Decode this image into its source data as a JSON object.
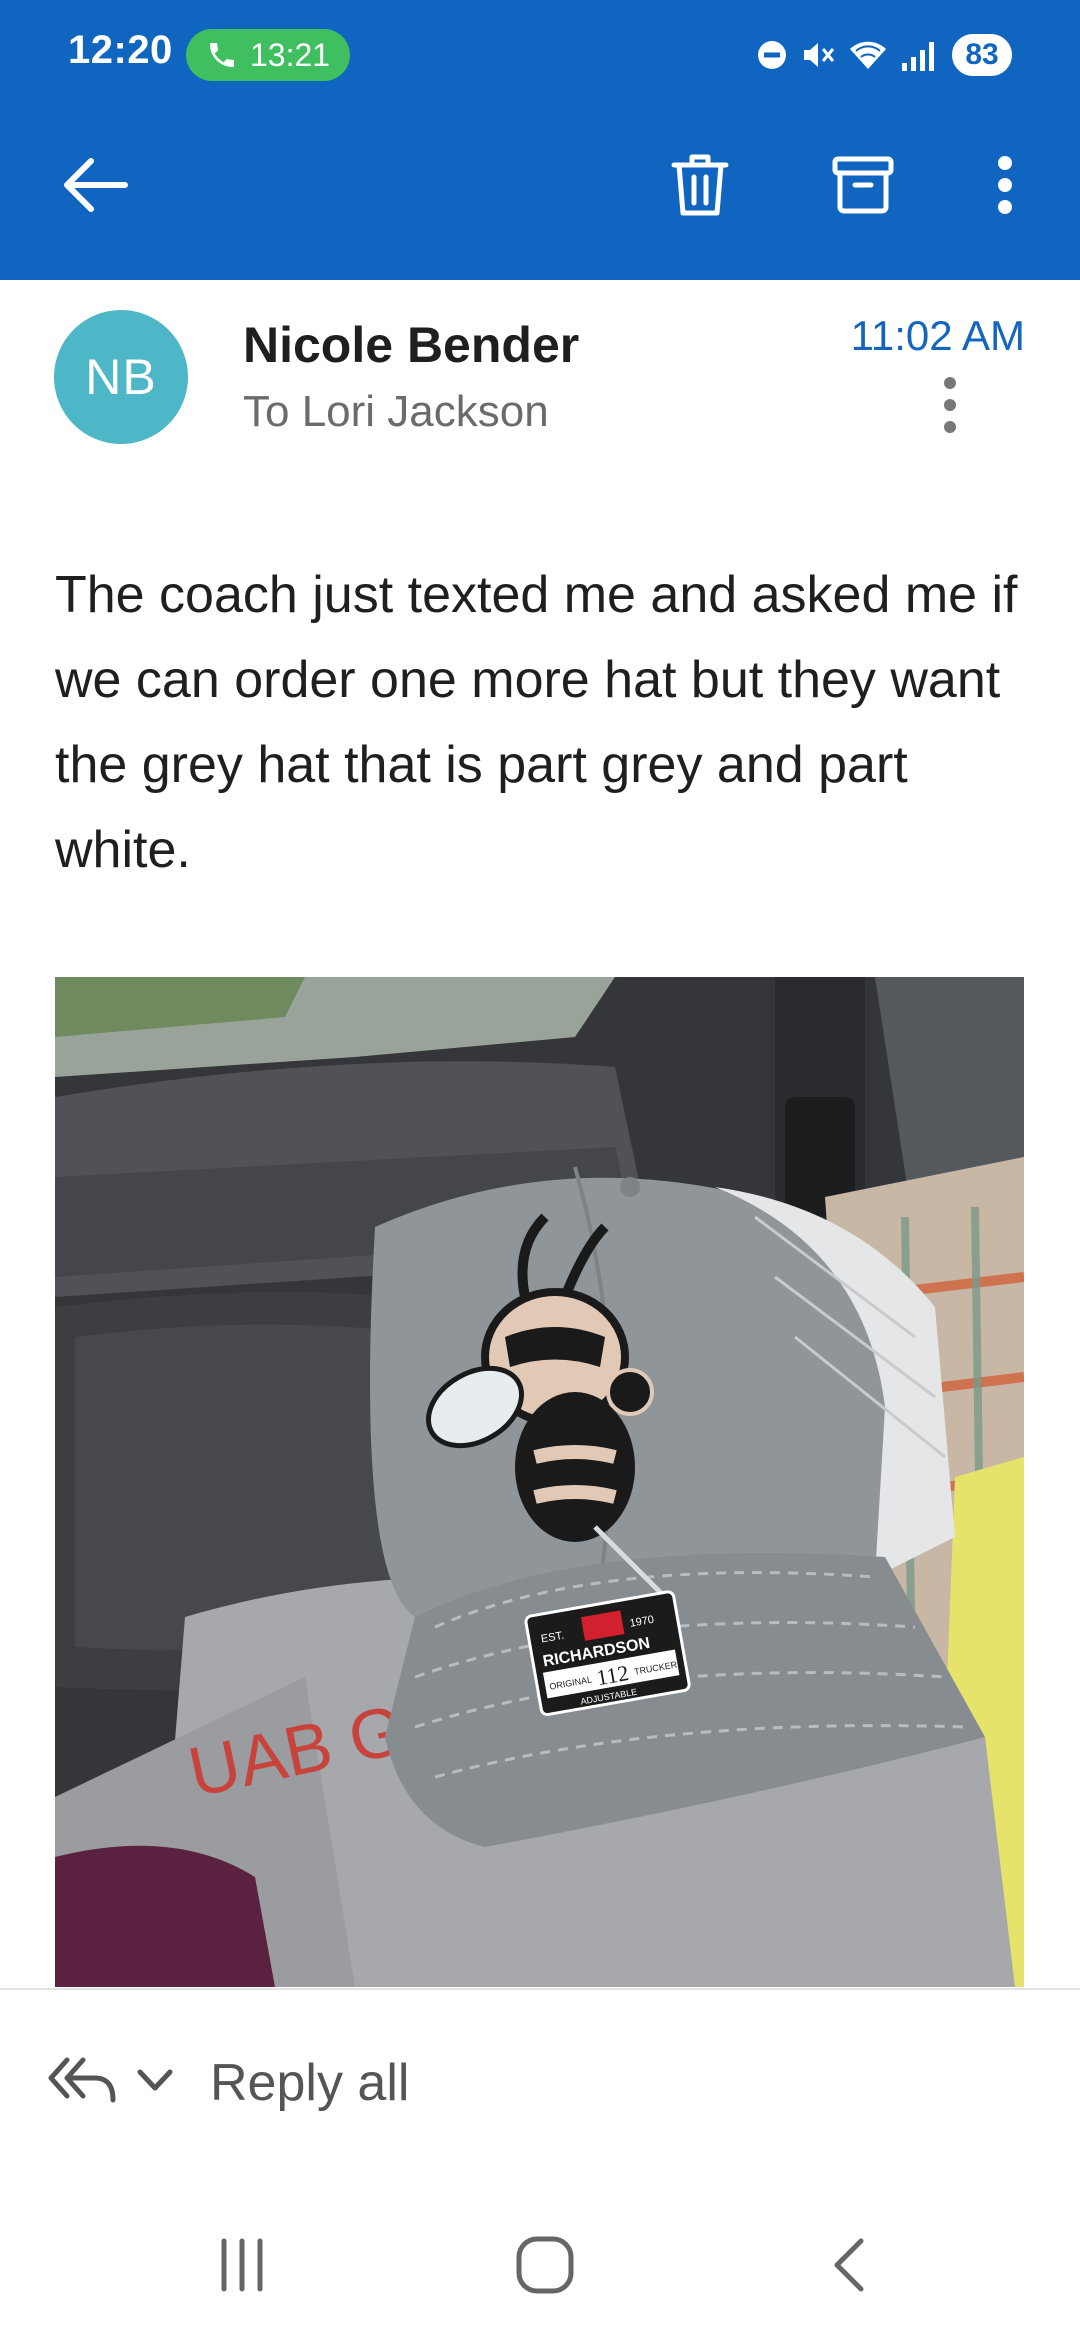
{
  "status_bar": {
    "time": "12:20",
    "call_duration": "13:21",
    "battery": "83",
    "icons": [
      "do-not-disturb-icon",
      "mute-icon",
      "wifi-icon",
      "signal-icon",
      "battery-icon"
    ]
  },
  "app_bar": {
    "actions": [
      "back-arrow-icon",
      "delete-icon",
      "archive-icon",
      "more-vert-icon"
    ]
  },
  "message": {
    "sender_initials": "NB",
    "sender_name": "Nicole Bender",
    "to_prefix": "To ",
    "recipient_name": "Lori Jackson",
    "time": "11:02 AM",
    "body": "The coach just texted me and asked me if we can order one more hat but they want the grey hat that is part grey and part white.",
    "attachment_alt": "grey and white trucker hat with yellow jacket logo"
  },
  "photo_text": {
    "shirt_text": "UAB G",
    "label_est": "EST.",
    "label_year": "1970",
    "label_brand": "RICHARDSON",
    "label_model": "112",
    "label_original": "ORIGINAL",
    "label_trucker": "TRUCKER",
    "label_adjustable": "ADJUSTABLE"
  },
  "reply": {
    "label": "Reply all"
  },
  "navigation": {
    "buttons": [
      "recents-icon",
      "home-icon",
      "back-icon"
    ]
  },
  "colors": {
    "header": "#0f65bf",
    "accent_time": "#1565c0",
    "avatar": "#4db6c7",
    "call_pill": "#3fbf5f"
  }
}
